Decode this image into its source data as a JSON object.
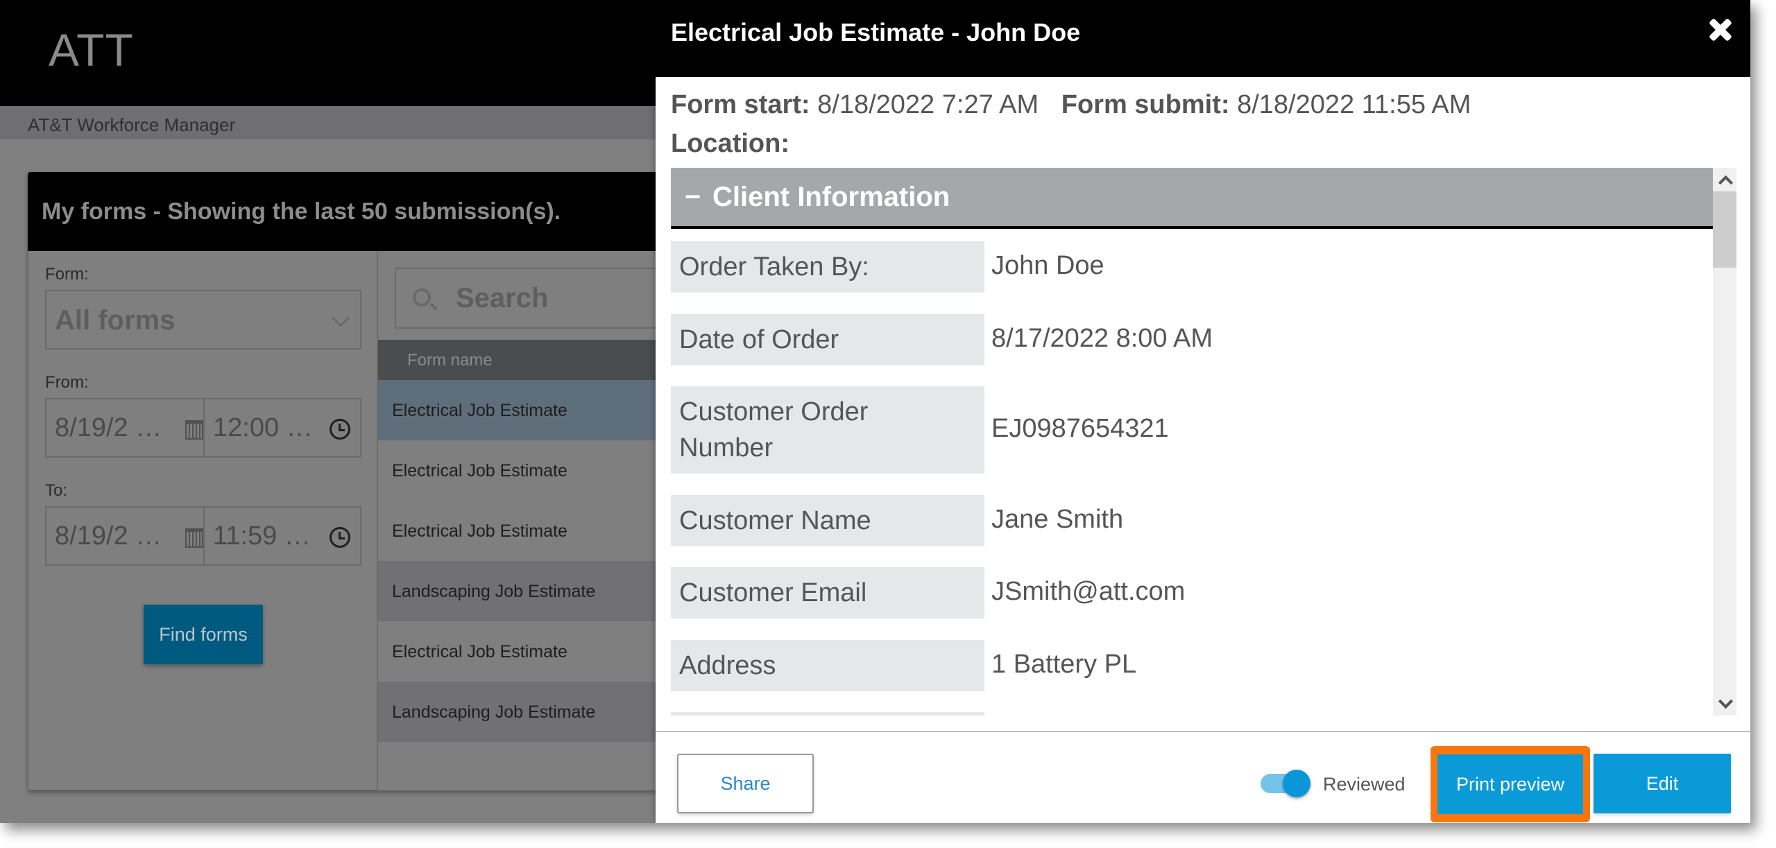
{
  "app": {
    "brand": "ATT",
    "subtitle": "AT&T Workforce Manager"
  },
  "forms_panel": {
    "title": "My forms - Showing the last 50 submission(s).",
    "filters": {
      "form_label": "Form:",
      "form_value": "All forms",
      "from_label": "From:",
      "from_date": "8/19/2 …",
      "from_time": "12:00 …",
      "to_label": "To:",
      "to_date": "8/19/2 …",
      "to_time": "11:59 …",
      "find_button": "Find forms"
    },
    "search_placeholder": "Search",
    "column_header": "Form name",
    "rows": [
      {
        "name": "Electrical Job Estimate",
        "selected": true
      },
      {
        "name": "Electrical Job Estimate"
      },
      {
        "name": "Electrical Job Estimate"
      },
      {
        "name": "Landscaping Job Estimate"
      },
      {
        "name": "Electrical Job Estimate"
      },
      {
        "name": "Landscaping Job Estimate"
      }
    ]
  },
  "modal": {
    "title": "Electrical Job Estimate - John Doe",
    "form_start_label": "Form start:",
    "form_start_value": "8/18/2022 7:27 AM",
    "form_submit_label": "Form submit:",
    "form_submit_value": "8/18/2022 11:55 AM",
    "location_label": "Location:",
    "section": {
      "toggle_symbol": "−",
      "title": "Client Information"
    },
    "fields": [
      {
        "label": "Order Taken By:",
        "value": "John Doe"
      },
      {
        "label": "Date of Order",
        "value": "8/17/2022 8:00 AM"
      },
      {
        "label": "Customer Order Number",
        "value": "EJ0987654321"
      },
      {
        "label": "Customer Name",
        "value": "Jane Smith"
      },
      {
        "label": "Customer Email",
        "value": "JSmith@att.com"
      },
      {
        "label": "Address",
        "value": "1 Battery PL"
      }
    ],
    "footer": {
      "share_button": "Share",
      "reviewed_label": "Reviewed",
      "reviewed_on": true,
      "print_preview_button": "Print preview",
      "edit_button": "Edit"
    }
  },
  "colors": {
    "accent_blue": "#0a9ad8",
    "highlight_orange": "#f7770f",
    "section_header_gray": "#a6a7aa",
    "field_label_bg": "#e6e7e8"
  }
}
